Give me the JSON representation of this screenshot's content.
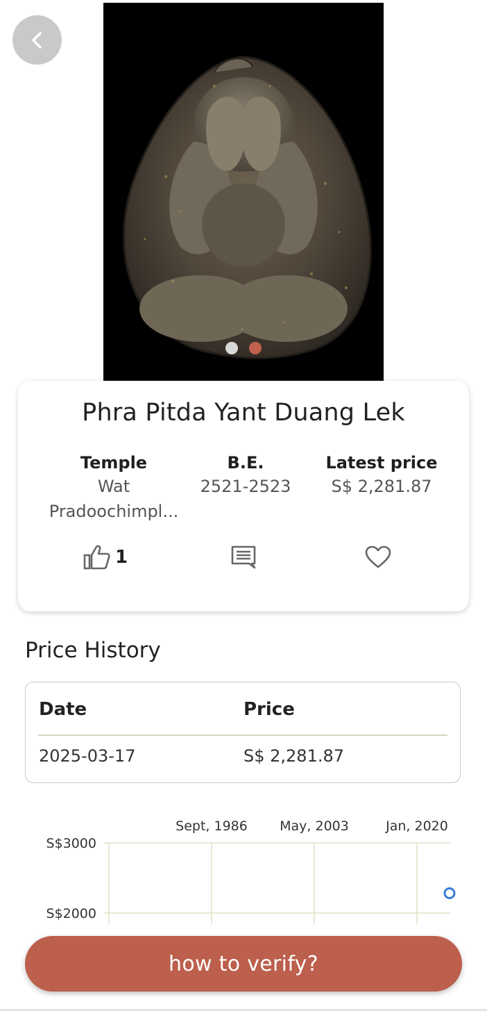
{
  "hero": {
    "image_alt": "Amulet photo",
    "carousel": {
      "dots": [
        {
          "state": "inactive",
          "color": "#d9d9d9"
        },
        {
          "state": "active",
          "color": "#c0604d"
        }
      ]
    }
  },
  "nav": {
    "back_icon": "chevron-left-icon"
  },
  "card": {
    "title": "Phra Pitda Yant Duang Lek",
    "temple": {
      "label": "Temple",
      "value": "Wat Pradoochimpl..."
    },
    "be": {
      "label": "B.E.",
      "value": "2521-2523"
    },
    "latest_price": {
      "label": "Latest price",
      "value": "S$ 2,281.87"
    },
    "actions": {
      "like_icon": "thumbs-up-icon",
      "like_count": "1",
      "comment_icon": "comment-icon",
      "favorite_icon": "heart-icon"
    }
  },
  "price_history": {
    "title": "Price History",
    "columns": [
      "Date",
      "Price"
    ],
    "rows": [
      {
        "date": "2025-03-17",
        "price": "S$ 2,281.87"
      }
    ]
  },
  "chart_data": {
    "type": "scatter",
    "x_tick_labels": [
      "Sept, 1986",
      "May, 2003",
      "Jan, 2020"
    ],
    "y_tick_labels": [
      "S$3000",
      "S$2000"
    ],
    "ylim": [
      2000,
      3000
    ],
    "grid": true,
    "series": [
      {
        "x": [
          "2025-03-17"
        ],
        "y": [
          2281.87
        ],
        "color": "#3a7bd5"
      }
    ]
  },
  "colors": {
    "accent": "#bc5f4c",
    "grid": "#e3dfc6"
  },
  "verify_button": {
    "label": "how to verify?"
  }
}
